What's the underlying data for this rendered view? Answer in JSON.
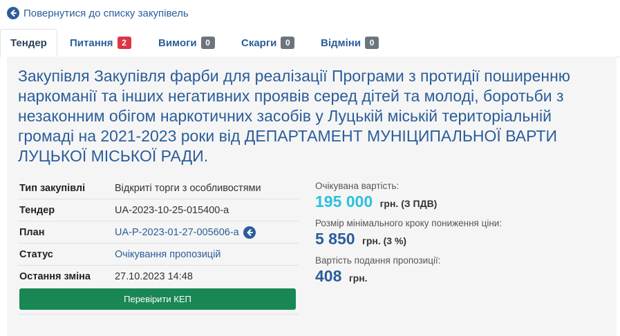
{
  "back_link": {
    "label": "Повернутися до списку закупівель",
    "icon": "arrow-left-circle-icon"
  },
  "tabs": [
    {
      "label": "Тендер",
      "active": true
    },
    {
      "label": "Питання",
      "badge": "2",
      "badge_color": "#dc3545"
    },
    {
      "label": "Вимоги",
      "badge": "0",
      "badge_color": "#6c757d"
    },
    {
      "label": "Скарги",
      "badge": "0",
      "badge_color": "#6c757d"
    },
    {
      "label": "Відміни",
      "badge": "0",
      "badge_color": "#6c757d"
    }
  ],
  "title": "Закупівля Закупівля фарби для реалізації Програми з протидії поширенню наркоманії та інших негативних проявів серед дітей та молоді, боротьби з незаконним обігом наркотичних засобів у Луцькій міській територіальній громаді на 2021-2023 роки від ДЕПАРТАМЕНТ МУНІЦИПАЛЬНОЇ ВАРТИ ЛУЦЬКОЇ МІСЬКОЇ РАДИ.",
  "info": {
    "rows": [
      {
        "key": "Тип закупівлі",
        "value": "Відкриті торги з особливостями"
      },
      {
        "key": "Тендер",
        "value": "UA-2023-10-25-015400-a"
      },
      {
        "key": "План",
        "value": "UA-P-2023-01-27-005606-a"
      },
      {
        "key": "Статус",
        "value": "Очікування пропозицій"
      },
      {
        "key": "Остання зміна",
        "value": "27.10.2023 14:48"
      }
    ],
    "kep_button": "Перевірити КЕП"
  },
  "pricing": {
    "expected_label": "Очікувана вартість:",
    "expected_amount": "195 000",
    "expected_unit": "грн. (З ПДВ)",
    "step_label": "Розмір мінімального кроку пониження ціни:",
    "step_amount": "5 850",
    "step_unit": "грн. (3 %)",
    "fee_label": "Вартість подання пропозиції:",
    "fee_amount": "408",
    "fee_unit": "грн."
  },
  "colors": {
    "link": "#2a5d9a",
    "accent_cyan": "#2bc0de",
    "button_green": "#198754",
    "badge_red": "#dc3545",
    "badge_gray": "#6c757d"
  }
}
